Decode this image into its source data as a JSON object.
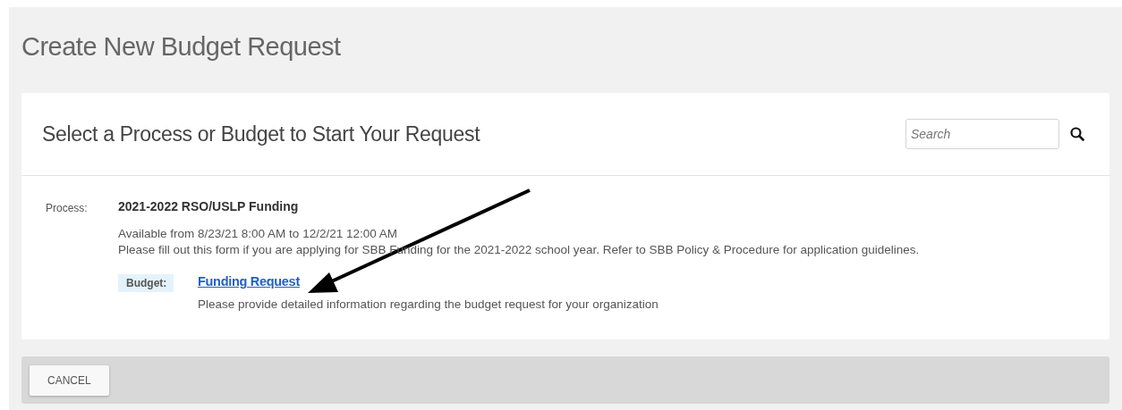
{
  "page": {
    "title": "Create New Budget Request"
  },
  "card": {
    "heading": "Select a Process or Budget to Start Your Request",
    "search": {
      "placeholder": "Search"
    }
  },
  "processes": [
    {
      "label": "Process:",
      "name": "2021-2022 RSO/USLP Funding",
      "availability": "Available from 8/23/21 8:00 AM to 12/2/21 12:00 AM",
      "description": "Please fill out this form if you are applying for SBB Funding for the 2021-2022 school year. Refer to SBB Policy & Procedure for application guidelines.",
      "budgets": [
        {
          "label": "Budget:",
          "name": "Funding Request",
          "description": "Please provide detailed information regarding the budget request for your organization"
        }
      ]
    }
  ],
  "footer": {
    "buttons": [
      "CANCEL"
    ]
  }
}
